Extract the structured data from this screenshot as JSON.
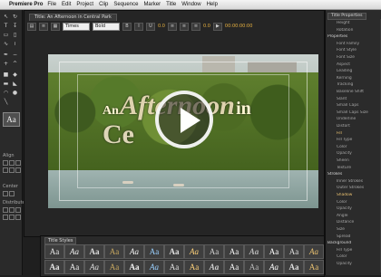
{
  "menubar": {
    "apple_glyph": "",
    "app_name": "Premiere Pro",
    "items": [
      "File",
      "Edit",
      "Project",
      "Clip",
      "Sequence",
      "Marker",
      "Title",
      "Window",
      "Help"
    ]
  },
  "title_window": {
    "tab_label": "Title: An Afternoon in Central Park",
    "font_family": "Times",
    "font_style": "Bold",
    "value_a": "0.0",
    "value_b": "0.0",
    "timecode": "00:00:00:00"
  },
  "video": {
    "title_line_1": "An",
    "title_line_2": "Afternoon",
    "title_line_3": "in",
    "title_line_4": "Ce"
  },
  "tools_panel": {
    "aa_label": "Aa",
    "align_label": "Align",
    "center_label": "Center",
    "distribute_label": "Distribute"
  },
  "styles_panel": {
    "title": "Title Styles",
    "swatches": [
      "Aa",
      "Aa",
      "Aa",
      "Aa",
      "Aa",
      "Aa",
      "Aa",
      "Aa",
      "Aa",
      "Aa",
      "Aa",
      "Aa",
      "Aa",
      "Aa",
      "Aa",
      "Aa",
      "Aa",
      "Aa",
      "Aa",
      "Aa",
      "Aa",
      "Aa",
      "Aa",
      "Aa",
      "Aa",
      "Aa",
      "Aa",
      "Aa"
    ]
  },
  "properties_panel": {
    "title": "Title Properties",
    "items": [
      {
        "label": "Height",
        "kind": "sub"
      },
      {
        "label": "Rotation",
        "kind": "sub"
      },
      {
        "label": "Properties",
        "kind": "hdr"
      },
      {
        "label": "Font Family",
        "kind": "sub"
      },
      {
        "label": "Font Style",
        "kind": "sub"
      },
      {
        "label": "Font Size",
        "kind": "sub"
      },
      {
        "label": "Aspect",
        "kind": "sub"
      },
      {
        "label": "Leading",
        "kind": "sub"
      },
      {
        "label": "Kerning",
        "kind": "sub"
      },
      {
        "label": "Tracking",
        "kind": "sub"
      },
      {
        "label": "Baseline Shift",
        "kind": "sub"
      },
      {
        "label": "Slant",
        "kind": "sub"
      },
      {
        "label": "Small Caps",
        "kind": "sub"
      },
      {
        "label": "Small Caps Size",
        "kind": "sub"
      },
      {
        "label": "Underline",
        "kind": "sub"
      },
      {
        "label": "Distort",
        "kind": "sub"
      },
      {
        "label": "Fill",
        "kind": "on"
      },
      {
        "label": "Fill Type",
        "kind": "sub"
      },
      {
        "label": "Color",
        "kind": "sub"
      },
      {
        "label": "Opacity",
        "kind": "sub"
      },
      {
        "label": "Sheen",
        "kind": "sub"
      },
      {
        "label": "Texture",
        "kind": "sub"
      },
      {
        "label": "Strokes",
        "kind": "hdr"
      },
      {
        "label": "Inner Strokes",
        "kind": "sub"
      },
      {
        "label": "Outer Strokes",
        "kind": "sub"
      },
      {
        "label": "Shadow",
        "kind": "on"
      },
      {
        "label": "Color",
        "kind": "sub"
      },
      {
        "label": "Opacity",
        "kind": "sub"
      },
      {
        "label": "Angle",
        "kind": "sub"
      },
      {
        "label": "Distance",
        "kind": "sub"
      },
      {
        "label": "Size",
        "kind": "sub"
      },
      {
        "label": "Spread",
        "kind": "sub"
      },
      {
        "label": "Background",
        "kind": "hdr"
      },
      {
        "label": "Fill Type",
        "kind": "sub"
      },
      {
        "label": "Color",
        "kind": "sub"
      },
      {
        "label": "Opacity",
        "kind": "sub"
      }
    ]
  }
}
